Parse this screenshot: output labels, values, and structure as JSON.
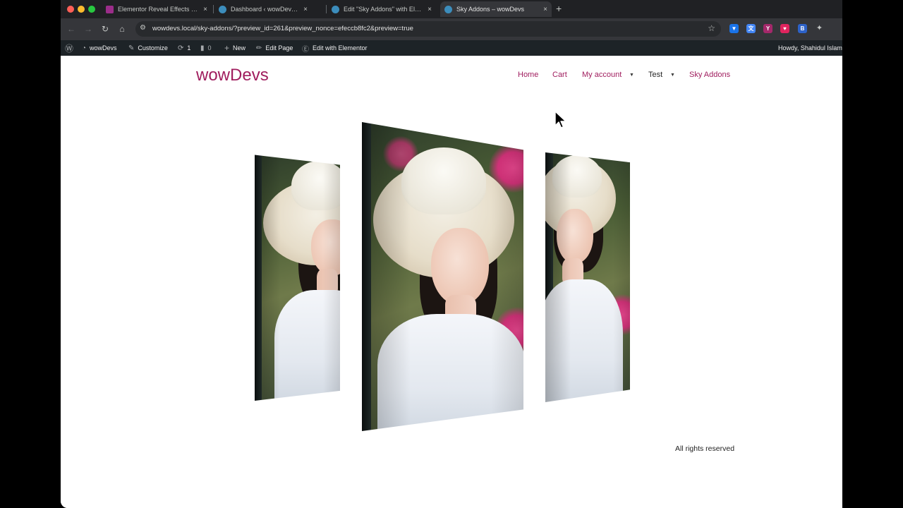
{
  "browser": {
    "tabs": [
      {
        "title": "Elementor Reveal Effects Exte",
        "favicon_color": "#9b2d8a",
        "favicon_glyph": "SA",
        "active": false
      },
      {
        "title": "Dashboard ‹ wowDevs — Wo",
        "favicon_color": "#3c8dbc",
        "favicon_glyph": "W",
        "active": false
      },
      {
        "title": "Edit \"Sky Addons\" with Eleme",
        "favicon_color": "#3c8dbc",
        "favicon_glyph": "W",
        "active": false
      },
      {
        "title": "Sky Addons – wowDevs",
        "favicon_color": "#3c8dbc",
        "favicon_glyph": "W",
        "active": true
      }
    ],
    "close_glyph": "×",
    "new_tab_glyph": "+",
    "url": "wowdevs.local/sky-addons/?preview_id=261&preview_nonce=efeccb8fc2&preview=true",
    "nav_icons": {
      "back": "back-arrow-icon",
      "forward": "forward-arrow-icon",
      "reload": "reload-icon",
      "home": "home-icon"
    },
    "extensions": [
      {
        "name": "shield-extension-icon",
        "color": "#1a73e8",
        "glyph": "▼"
      },
      {
        "name": "translate-extension-icon",
        "color": "#4285f4",
        "glyph": "文"
      },
      {
        "name": "yoast-extension-icon",
        "color": "#a4286a",
        "glyph": "Y"
      },
      {
        "name": "pocket-extension-icon",
        "color": "#e0245e",
        "glyph": "♥"
      },
      {
        "name": "blue-extension-icon",
        "color": "#2d62c8",
        "glyph": "B"
      },
      {
        "name": "puzzle-extension-icon",
        "color": "#35363a",
        "glyph": "✦"
      }
    ]
  },
  "adminbar": {
    "site_name": "wowDevs",
    "customize": "Customize",
    "updates_count": "1",
    "comments_count": "0",
    "new": "New",
    "edit_page": "Edit Page",
    "edit_with_elementor": "Edit with Elementor",
    "howdy": "Howdy, Shahidul Islam"
  },
  "site": {
    "logo": "wowDevs",
    "brand_color": "#a01d5e",
    "menu": {
      "home": "Home",
      "cart": "Cart",
      "my_account": "My account",
      "test": "Test",
      "sky_addons": "Sky Addons",
      "caret": "▼"
    },
    "footer": "All rights reserved"
  }
}
